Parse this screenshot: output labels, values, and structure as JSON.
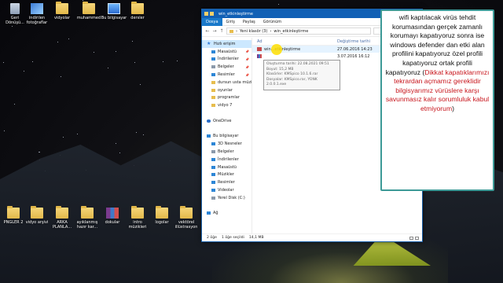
{
  "desktop": {
    "icons_top": [
      {
        "label": "Geri Dönüşü...",
        "icon": "recycle-bin-icon"
      },
      {
        "label": "indirilen fotoğraflar",
        "icon": "photos-folder-icon"
      },
      {
        "label": "vidyolar",
        "icon": "folder-icon"
      },
      {
        "label": "muhammed",
        "icon": "folder-icon"
      },
      {
        "label": "Bu bilgisayar",
        "icon": "computer-icon"
      },
      {
        "label": "dersler",
        "icon": "folder-icon"
      }
    ],
    "icons_bottom": [
      {
        "label": "PNGLER 2",
        "icon": "folder-icon"
      },
      {
        "label": "vidyo arşivi",
        "icon": "folder-icon"
      },
      {
        "label": "ARKA PLANLA...",
        "icon": "folder-icon"
      },
      {
        "label": "ayıklanmış hazır kar...",
        "icon": "folder-icon"
      },
      {
        "label": "dokular",
        "icon": "archive-icon"
      },
      {
        "label": "intro müzikleri",
        "icon": "folder-icon"
      },
      {
        "label": "logolar",
        "icon": "folder-icon"
      },
      {
        "label": "vektörel illüstrasyon",
        "icon": "folder-icon"
      }
    ]
  },
  "window": {
    "title": "win_etkinleştirme",
    "ribbon_tabs": [
      "Dosya",
      "Giriş",
      "Paylaş",
      "Görünüm"
    ],
    "address": {
      "back": "←",
      "forward": "→",
      "up": "↑",
      "path_parts": [
        "Yeni klasör (3)",
        "win_etkinleştirme"
      ],
      "separator": "›"
    },
    "nav": [
      {
        "label": "Hızlı erişim",
        "icon": "star",
        "sel": true
      },
      {
        "label": "Masaüstü",
        "icon": "blue",
        "sub": true,
        "pin": true
      },
      {
        "label": "İndirilenler",
        "icon": "blue",
        "sub": true,
        "pin": true
      },
      {
        "label": "Belgeler",
        "icon": "gray",
        "sub": true,
        "pin": true
      },
      {
        "label": "Resimler",
        "icon": "blue",
        "sub": true,
        "pin": true
      },
      {
        "label": "dursun usta müzik",
        "icon": "yellow",
        "sub": true
      },
      {
        "label": "oyunlar",
        "icon": "yellow",
        "sub": true
      },
      {
        "label": "programlar",
        "icon": "yellow",
        "sub": true
      },
      {
        "label": "vidyo 7",
        "icon": "yellow",
        "sub": true
      },
      {
        "label": "",
        "icon": "",
        "sub": true
      },
      {
        "label": "OneDrive",
        "icon": "cloud"
      },
      {
        "label": "",
        "icon": ""
      },
      {
        "label": "Bu bilgisayar",
        "icon": "blue"
      },
      {
        "label": "3D Nesneler",
        "icon": "blue",
        "sub": true
      },
      {
        "label": "Belgeler",
        "icon": "gray",
        "sub": true
      },
      {
        "label": "İndirilenler",
        "icon": "blue",
        "sub": true
      },
      {
        "label": "Masaüstü",
        "icon": "blue",
        "sub": true
      },
      {
        "label": "Müzikler",
        "icon": "blue",
        "sub": true
      },
      {
        "label": "Resimler",
        "icon": "blue",
        "sub": true
      },
      {
        "label": "Videolar",
        "icon": "blue",
        "sub": true
      },
      {
        "label": "Yerel Disk (C:)",
        "icon": "gray",
        "sub": true
      },
      {
        "label": "",
        "icon": ""
      },
      {
        "label": "Ağ",
        "icon": "blue"
      }
    ],
    "columns": {
      "name": "Ad",
      "date": "Değiştirme tarihi"
    },
    "files": [
      {
        "name": "win...etkinleştirme",
        "date": "27.06.2016 14:23",
        "icon": "red"
      },
      {
        "name": "",
        "date": "3.07.2016 16:12",
        "icon": "rar"
      }
    ],
    "tooltip": {
      "line1": "Oluşturma tarihi: 22.08.2021 09:51",
      "line2": "Boyut: 15,2 MB",
      "line3": "Klasörler: KMSpico 10.1.6.rar",
      "line4": "Dosyalar: KMSpico.rar, YONK 2.0.0.1.exe"
    },
    "status": {
      "count": "2 öğe",
      "selected": "1 öğe seçildi",
      "size": "14,1 MB"
    }
  },
  "note": {
    "text": "wifi kaptılacak virüs tehdit korumasından gerçek zamanlı korumayı kapatıyoruz sonra ise windows defender dan etki alan profilini kapatıyoruz özel profili kapatıyoruz ortak profili kapatıyoruz (",
    "warning": "Dikkat kapatıklarımızı tekrardan açmamız gereklidir bilgisyarımız vürüslere karşı savunmasız kalır sorumluluk kabul etmiyorum",
    "close": ")",
    "border_color": "#3d9a97",
    "warning_color": "#c8161d"
  }
}
